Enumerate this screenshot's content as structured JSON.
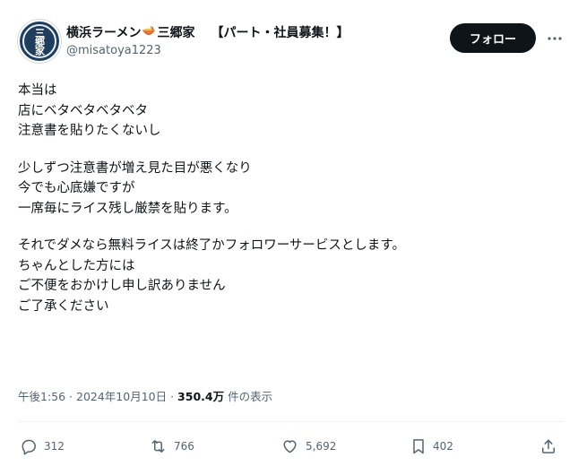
{
  "author": {
    "display_name_part1": "横浜ラーメン",
    "display_name_part2": "三郷家",
    "display_name_part3": "【パート・社員募集！】",
    "handle": "@misatoya1223",
    "avatar_logo_text": "三郷家",
    "name_icon": "ramen-bowl-icon"
  },
  "follow_button": {
    "label": "フォロー"
  },
  "more_menu": {
    "icon": "more-dots-icon"
  },
  "post": {
    "paragraphs": [
      [
        "本当は",
        "店にベタベタベタベタ",
        "注意書を貼りたくないし"
      ],
      [
        "少しずつ注意書が増え見た目が悪くなり",
        "今でも心底嫌ですが",
        "一席毎にライス残し厳禁を貼ります。"
      ],
      [
        "それでダメなら無料ライスは終了かフォロワーサービスとします。",
        "ちゃんとした方には",
        "ご不便をおかけし申し訳ありません",
        "ご了承ください"
      ]
    ]
  },
  "meta": {
    "time": "午後1:56",
    "separator": " · ",
    "date": "2024年10月10日",
    "views_count": "350.4万",
    "views_label": " 件の表示"
  },
  "actions": {
    "reply": {
      "icon": "reply-icon",
      "count": "312"
    },
    "repost": {
      "icon": "repost-icon",
      "count": "766"
    },
    "like": {
      "icon": "heart-icon",
      "count": "5,692"
    },
    "bookmark": {
      "icon": "bookmark-icon",
      "count": "402"
    },
    "share": {
      "icon": "share-icon"
    }
  },
  "colors": {
    "text": "#0f1419",
    "secondary_text": "#536471",
    "follow_bg": "#0f1419",
    "avatar_bg": "#1f3d5c"
  }
}
